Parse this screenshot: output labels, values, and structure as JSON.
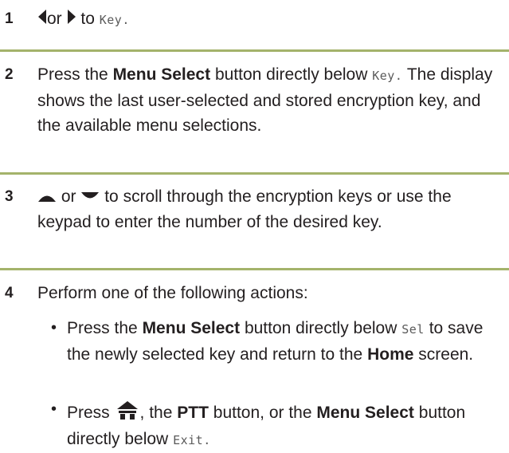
{
  "steps": [
    {
      "number": "1",
      "left_icon": "left-arrow-key-icon",
      "or_word": "or",
      "right_icon": "right-arrow-key-icon",
      "to_word": "to",
      "key_label": "Key."
    },
    {
      "number": "2",
      "press_word": "Press the",
      "bold_label": "Menu Select",
      "rest": "button directly below",
      "key_label": "Key.",
      "line2": "The display shows the last user-selected and stored encryption key, and the available menu selections."
    },
    {
      "number": "3",
      "up_icon": "up-arrow-key-icon",
      "or_word": "or",
      "down_icon": "down-arrow-key-icon",
      "text": "to scroll through the encryption keys or use the keypad to enter the number of the desired key."
    },
    {
      "number": "4",
      "text": "Perform one of the following actions:",
      "bullets": [
        {
          "bullet": "•",
          "press_word": "Press the",
          "bold_label": "Menu Select",
          "below_text": "button directly below",
          "sel_label": "Sel",
          "after_sel": "to save the newly selected key and return to the",
          "home_label": "Home",
          "end": "screen."
        },
        {
          "bullet": "•",
          "press_word": "Press",
          "home_icon": "home-button-icon",
          "comma_the": ", the",
          "ptt_label": "PTT",
          "mid": "button, or the",
          "bold_label": "Menu Select",
          "below_text": "button directly below",
          "exit_label": "Exit."
        }
      ]
    }
  ],
  "colors": {
    "divider": "#a4b36b",
    "text": "#231f20",
    "mono_text": "#5a5a5a"
  }
}
